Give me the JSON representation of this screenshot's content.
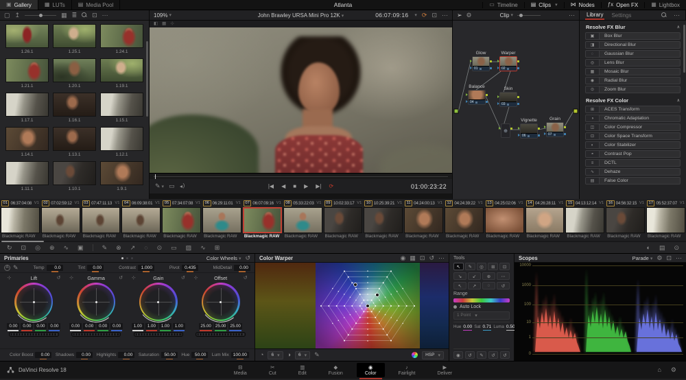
{
  "top_bar": {
    "title": "Atlanta",
    "left_tabs": [
      {
        "label": "Gallery",
        "icon": "gallery-icon",
        "glyph": "▣",
        "active": true
      },
      {
        "label": "LUTs",
        "icon": "luts-icon",
        "glyph": "▦",
        "active": false
      },
      {
        "label": "Media Pool",
        "icon": "media-pool-icon",
        "glyph": "▤",
        "active": false
      }
    ],
    "right_tabs": [
      {
        "label": "Timeline",
        "icon": "timeline-icon",
        "glyph": "▭",
        "dropdown": false,
        "active": false
      },
      {
        "label": "Clips",
        "icon": "clips-icon",
        "glyph": "▤",
        "dropdown": true,
        "active": true
      },
      {
        "label": "Nodes",
        "icon": "nodes-icon",
        "glyph": "⋈",
        "dropdown": false,
        "active": true
      },
      {
        "label": "Open FX",
        "icon": "openfx-icon",
        "glyph": "ƒx",
        "dropdown": false,
        "active": true
      },
      {
        "label": "Lightbox",
        "icon": "lightbox-icon",
        "glyph": "▦",
        "dropdown": false,
        "active": false
      }
    ]
  },
  "gallery": {
    "toolbar_icons": [
      {
        "name": "still-icon",
        "glyph": "▢"
      },
      {
        "name": "export-still-icon",
        "glyph": "↥"
      },
      {
        "name": "grid-view-icon",
        "glyph": "▦"
      },
      {
        "name": "list-view-icon",
        "glyph": "≣"
      },
      {
        "name": "expand-icon",
        "glyph": "⊡"
      },
      {
        "name": "more-icon",
        "glyph": "⋯"
      }
    ],
    "stills": [
      {
        "label": "1.26.1",
        "v": "vA"
      },
      {
        "label": "1.25.1",
        "v": "vB"
      },
      {
        "label": "1.24.1",
        "v": "vC"
      },
      {
        "label": "1.21.1",
        "v": "vC"
      },
      {
        "label": "1.20.1",
        "v": "vD"
      },
      {
        "label": "1.19.1",
        "v": "vB"
      },
      {
        "label": "1.17.1",
        "v": "vF"
      },
      {
        "label": "1.16.1",
        "v": "vG"
      },
      {
        "label": "1.15.1",
        "v": "vF"
      },
      {
        "label": "1.14.1",
        "v": "vE"
      },
      {
        "label": "1.13.1",
        "v": "vG"
      },
      {
        "label": "1.12.1",
        "v": "vF"
      },
      {
        "label": "1.11.1",
        "v": "vF"
      },
      {
        "label": "1.10.1",
        "v": "vI"
      },
      {
        "label": "1.9.1",
        "v": "vE"
      }
    ]
  },
  "viewer": {
    "zoom": "109%",
    "clip_name": "John Brawley URSA Mini Pro 12K",
    "timecode": "06:07:09:16",
    "duration": "01:00:23:22",
    "transport": [
      {
        "name": "go-start-button",
        "glyph": "|◀"
      },
      {
        "name": "step-back-button",
        "glyph": "◀"
      },
      {
        "name": "stop-button",
        "glyph": "■"
      },
      {
        "name": "step-forward-button",
        "glyph": "▶"
      },
      {
        "name": "go-end-button",
        "glyph": "▶|"
      },
      {
        "name": "loop-button",
        "glyph": "⟳",
        "accent": true
      }
    ]
  },
  "node_editor": {
    "mode": "Clip",
    "nodes": [
      {
        "num": "01",
        "label": "Glow",
        "selected": false,
        "v": "vN"
      },
      {
        "num": "02",
        "label": "Warper",
        "selected": true,
        "v": "vN"
      },
      {
        "num": "04",
        "label": "Balance",
        "selected": false,
        "v": "vE"
      },
      {
        "num": "03",
        "label": "Skin",
        "selected": false,
        "v": "vO"
      },
      {
        "num": "06",
        "label": "Vignette",
        "selected": false,
        "v": "vO"
      },
      {
        "num": "07",
        "label": "Grain",
        "selected": false,
        "v": "vN"
      }
    ]
  },
  "library": {
    "tabs": {
      "library": "Library",
      "settings": "Settings"
    },
    "sections": [
      {
        "title": "Resolve FX Blur",
        "items": [
          {
            "label": "Box Blur",
            "glyph": "▣"
          },
          {
            "label": "Directional Blur",
            "glyph": "◨"
          },
          {
            "label": "Gaussian Blur",
            "glyph": "◌"
          },
          {
            "label": "Lens Blur",
            "glyph": "◎"
          },
          {
            "label": "Mosaic Blur",
            "glyph": "▦"
          },
          {
            "label": "Radial Blur",
            "glyph": "◉"
          },
          {
            "label": "Zoom Blur",
            "glyph": "⊙"
          }
        ]
      },
      {
        "title": "Resolve FX Color",
        "items": [
          {
            "label": "ACES Transform",
            "glyph": "⊞"
          },
          {
            "label": "Chromatic Adaptation",
            "glyph": "◑"
          },
          {
            "label": "Color Compressor",
            "glyph": "◫"
          },
          {
            "label": "Color Space Transform",
            "glyph": "⊡"
          },
          {
            "label": "Color Stabilizer",
            "glyph": "◐"
          },
          {
            "label": "Contrast Pop",
            "glyph": "◓"
          },
          {
            "label": "DCTL",
            "glyph": "≡"
          },
          {
            "label": "Dehaze",
            "glyph": "∿"
          },
          {
            "label": "False Color",
            "glyph": "▤"
          }
        ]
      }
    ]
  },
  "timeline": {
    "codec": "Blackmagic RAW",
    "clips": [
      {
        "num": "01",
        "tc": "06:37:04:08",
        "track": "V1",
        "v": "vH",
        "selected": false
      },
      {
        "num": "02",
        "tc": "07:02:59:12",
        "track": "V1",
        "v": "vJ",
        "selected": false
      },
      {
        "num": "03",
        "tc": "07:47:11:13",
        "track": "V1",
        "v": "vJ",
        "selected": false
      },
      {
        "num": "04",
        "tc": "06:09:38:01",
        "track": "V1",
        "v": "vJ",
        "selected": false
      },
      {
        "num": "05",
        "tc": "07:34:07:08",
        "track": "V1",
        "v": "vC",
        "selected": false
      },
      {
        "num": "06",
        "tc": "06:29:11:01",
        "track": "V1",
        "v": "vK",
        "selected": false
      },
      {
        "num": "07",
        "tc": "06:07:09:16",
        "track": "V1",
        "v": "vC",
        "selected": true
      },
      {
        "num": "08",
        "tc": "05:33:22:03",
        "track": "V1",
        "v": "vK",
        "selected": false
      },
      {
        "num": "09",
        "tc": "10:02:33:17",
        "track": "V1",
        "v": "vI",
        "selected": false
      },
      {
        "num": "10",
        "tc": "10:25:39:21",
        "track": "V1",
        "v": "vI",
        "selected": false
      },
      {
        "num": "11",
        "tc": "04:24:00:13",
        "track": "V1",
        "v": "vE",
        "selected": false
      },
      {
        "num": "12",
        "tc": "04:24:39:22",
        "track": "V1",
        "v": "vE",
        "selected": false
      },
      {
        "num": "13",
        "tc": "04:25:02:06",
        "track": "V1",
        "v": "vL",
        "selected": false
      },
      {
        "num": "14",
        "tc": "04:26:28:11",
        "track": "V1",
        "v": "vM",
        "selected": false
      },
      {
        "num": "15",
        "tc": "04:13:12:14",
        "track": "V1",
        "v": "vF",
        "selected": false
      },
      {
        "num": "16",
        "tc": "04:56:32:15",
        "track": "V1",
        "v": "vI",
        "selected": false
      },
      {
        "num": "17",
        "tc": "05:52:37:07",
        "track": "V1",
        "v": "vH",
        "selected": false
      }
    ]
  },
  "mid_toolbar": {
    "left_icons": [
      {
        "name": "tracker-icon",
        "glyph": "↻"
      },
      {
        "name": "sizing-icon",
        "glyph": "⊡"
      },
      {
        "name": "stabilizer-icon",
        "glyph": "◎"
      },
      {
        "name": "magic-mask-icon",
        "glyph": "⊕"
      },
      {
        "name": "smoothing-icon",
        "glyph": "∿"
      },
      {
        "name": "patch-icon",
        "glyph": "▣"
      }
    ],
    "mid_icons": [
      {
        "name": "pen-icon",
        "glyph": "✎"
      },
      {
        "name": "blur-tool-icon",
        "glyph": "⊗"
      },
      {
        "name": "curve-icon",
        "glyph": "↗"
      },
      {
        "name": "circle-window-icon",
        "glyph": "◌"
      },
      {
        "name": "radial-window-icon",
        "glyph": "⊙"
      },
      {
        "name": "rect-window-icon",
        "glyph": "▭"
      },
      {
        "name": "gradient-window-icon",
        "glyph": "▨"
      },
      {
        "name": "wave-icon",
        "glyph": "∿"
      },
      {
        "name": "grid-icon",
        "glyph": "⊞"
      }
    ],
    "right_icons": [
      {
        "name": "split-icon",
        "glyph": "◐"
      },
      {
        "name": "keyframe-panel-icon",
        "glyph": "▤"
      },
      {
        "name": "info-icon",
        "glyph": "⊙"
      }
    ]
  },
  "primaries": {
    "title": "Primaries",
    "mode": "Color Wheels",
    "top_params": [
      {
        "label": "Temp",
        "value": "0.0"
      },
      {
        "label": "Tint",
        "value": "0.00"
      },
      {
        "label": "Contrast",
        "value": "1.000"
      },
      {
        "label": "Pivot",
        "value": "0.435"
      },
      {
        "label": "MidDetail",
        "value": "0.00"
      }
    ],
    "wheels": [
      {
        "name": "Lift",
        "values": [
          "0.00",
          "0.00",
          "0.00",
          "0.00"
        ]
      },
      {
        "name": "Gamma",
        "values": [
          "0.00",
          "0.00",
          "0.00",
          "0.00"
        ]
      },
      {
        "name": "Gain",
        "values": [
          "1.00",
          "1.00",
          "1.00",
          "1.00"
        ]
      },
      {
        "name": "Offset",
        "values": [
          "25.00",
          "25.00",
          "25.00"
        ]
      }
    ],
    "bottom_params": [
      {
        "label": "Color Boost",
        "value": "0.00"
      },
      {
        "label": "Shadows",
        "value": "0.00"
      },
      {
        "label": "Highlights",
        "value": "0.00"
      },
      {
        "label": "Saturation",
        "value": "50.00"
      },
      {
        "label": "Hue",
        "value": "50.00"
      },
      {
        "label": "Lum Mix",
        "value": "100.00"
      }
    ]
  },
  "warper": {
    "title": "Color Warper",
    "hue_steps": "6",
    "sat_steps": "6",
    "mode": "HSP"
  },
  "tools": {
    "title": "Tools",
    "range_label": "Range",
    "auto_lock": "Auto Lock",
    "points_mode": "1 Point",
    "params": [
      {
        "label": "Hue",
        "value": "0.00",
        "uc": "#c23ec2"
      },
      {
        "label": "Sat",
        "value": "0.71",
        "uc": "#3c9cc8"
      },
      {
        "label": "Luma",
        "value": "0.50",
        "uc": "#bdbdbd"
      }
    ]
  },
  "scopes": {
    "title": "Scopes",
    "mode": "Parade",
    "ticks": [
      "10000",
      "1000",
      "100",
      "10",
      "1",
      "0"
    ]
  },
  "bottom_bar": {
    "app_name": "DaVinci Resolve 18",
    "pages": [
      {
        "label": "Media",
        "glyph": "⊟",
        "active": false
      },
      {
        "label": "Cut",
        "glyph": "✂",
        "active": false
      },
      {
        "label": "Edit",
        "glyph": "▥",
        "active": false
      },
      {
        "label": "Fusion",
        "glyph": "◆",
        "active": false
      },
      {
        "label": "Color",
        "glyph": "◉",
        "active": true
      },
      {
        "label": "Fairlight",
        "glyph": "♪",
        "active": false
      },
      {
        "label": "Deliver",
        "glyph": "▶",
        "active": false
      }
    ]
  }
}
